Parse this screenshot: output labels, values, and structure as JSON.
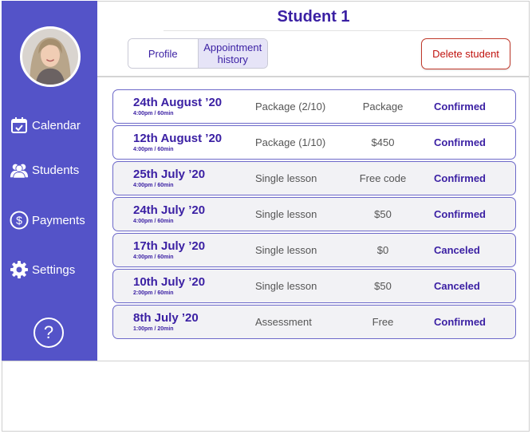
{
  "header": {
    "title": "Student 1",
    "tabs": [
      {
        "label": "Profile"
      },
      {
        "label": "Appointment history"
      }
    ],
    "delete_label": "Delete student"
  },
  "sidebar": {
    "items": [
      {
        "label": "Calendar",
        "icon": "calendar-check-icon"
      },
      {
        "label": "Students",
        "icon": "students-icon"
      },
      {
        "label": "Payments",
        "icon": "dollar-icon"
      },
      {
        "label": "Settings",
        "icon": "gear-icon"
      }
    ],
    "help_label": "?"
  },
  "appointments": [
    {
      "date": "24th August ’20",
      "time": "4:00pm / 60min",
      "type": "Package (2/10)",
      "price": "Package",
      "status": "Confirmed"
    },
    {
      "date": "12th August ’20",
      "time": "4:00pm / 60min",
      "type": "Package (1/10)",
      "price": "$450",
      "status": "Confirmed"
    },
    {
      "date": "25th July ’20",
      "time": "4:00pm / 60min",
      "type": "Single lesson",
      "price": "Free code",
      "status": "Confirmed"
    },
    {
      "date": "24th July ’20",
      "time": "4:00pm / 60min",
      "type": "Single lesson",
      "price": "$50",
      "status": "Confirmed"
    },
    {
      "date": "17th July ’20",
      "time": "4:00pm / 60min",
      "type": "Single lesson",
      "price": "$0",
      "status": "Canceled"
    },
    {
      "date": "10th July ’20",
      "time": "2:00pm / 60min",
      "type": "Single lesson",
      "price": "$50",
      "status": "Canceled"
    },
    {
      "date": "8th July ’20",
      "time": "1:00pm / 20min",
      "type": "Assessment",
      "price": "Free",
      "status": "Confirmed"
    }
  ],
  "colors": {
    "sidebar": "#5453c8",
    "accent": "#3a1fa3",
    "danger": "#c0130f"
  }
}
